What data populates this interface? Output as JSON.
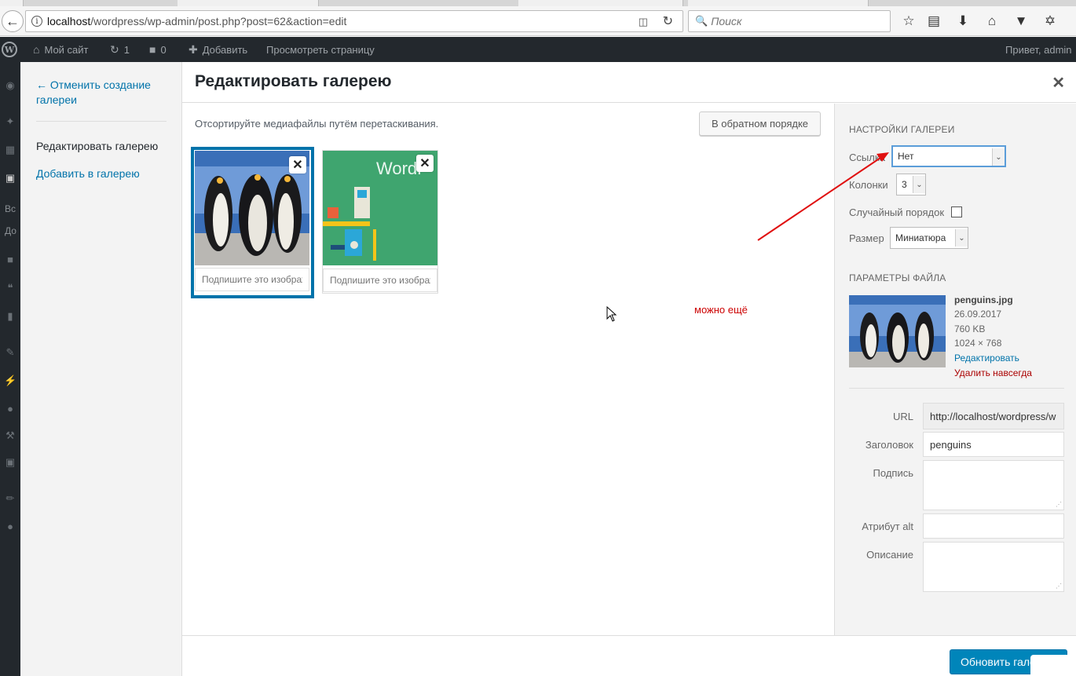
{
  "browser": {
    "url_host": "localhost",
    "url_path": "/wordpress/wp-admin/post.php?post=62&action=edit",
    "search_placeholder": "Поиск"
  },
  "adminbar": {
    "site_name": "Мой сайт",
    "updates_count": "1",
    "comments_count": "0",
    "add_label": "Добавить",
    "view_page_label": "Просмотреть страницу",
    "greeting": "Привет, admin"
  },
  "wp_sidebar": {
    "partial_1": "Вс",
    "partial_2": "До"
  },
  "menu": {
    "cancel_label": "← Отменить создание галереи",
    "edit_gallery_label": "Редактировать галерею",
    "add_to_gallery_label": "Добавить в галерею"
  },
  "modal": {
    "title": "Редактировать галерею",
    "close_icon": "close-icon"
  },
  "content": {
    "instructions": "Отсортируйте медиафайлы путём перетаскивания.",
    "reverse_label": "В обратном порядке",
    "items": [
      {
        "caption_placeholder": "Подпишите это изображение"
      },
      {
        "caption_placeholder": "Подпишите это изображение",
        "overlay_text": "WordP"
      }
    ],
    "annotation": "можно ещё"
  },
  "gallery_settings": {
    "heading": "Настройки галереи",
    "link_label": "Ссылка",
    "link_value": "Нет",
    "columns_label": "Колонки",
    "columns_value": "3",
    "random_label": "Случайный порядок",
    "random_checked": false,
    "size_label": "Размер",
    "size_value": "Миниатюра"
  },
  "attachment": {
    "heading": "Параметры файла",
    "filename": "penguins.jpg",
    "date": "26.09.2017",
    "filesize": "760 KB",
    "dimensions": "1024 × 768",
    "edit_label": "Редактировать",
    "delete_label": "Удалить навсегда",
    "url_label": "URL",
    "url_value": "http://localhost/wordpress/w",
    "title_label": "Заголовок",
    "title_value": "penguins",
    "caption_label": "Подпись",
    "alt_label": "Атрибут alt",
    "description_label": "Описание"
  },
  "footer": {
    "update_label": "Обновить галерею"
  },
  "colors": {
    "link": "#0073aa",
    "primary_button": "#0085ba",
    "delete": "#aa0000",
    "annotation": "#cc0000",
    "adminbar": "#23282d"
  }
}
